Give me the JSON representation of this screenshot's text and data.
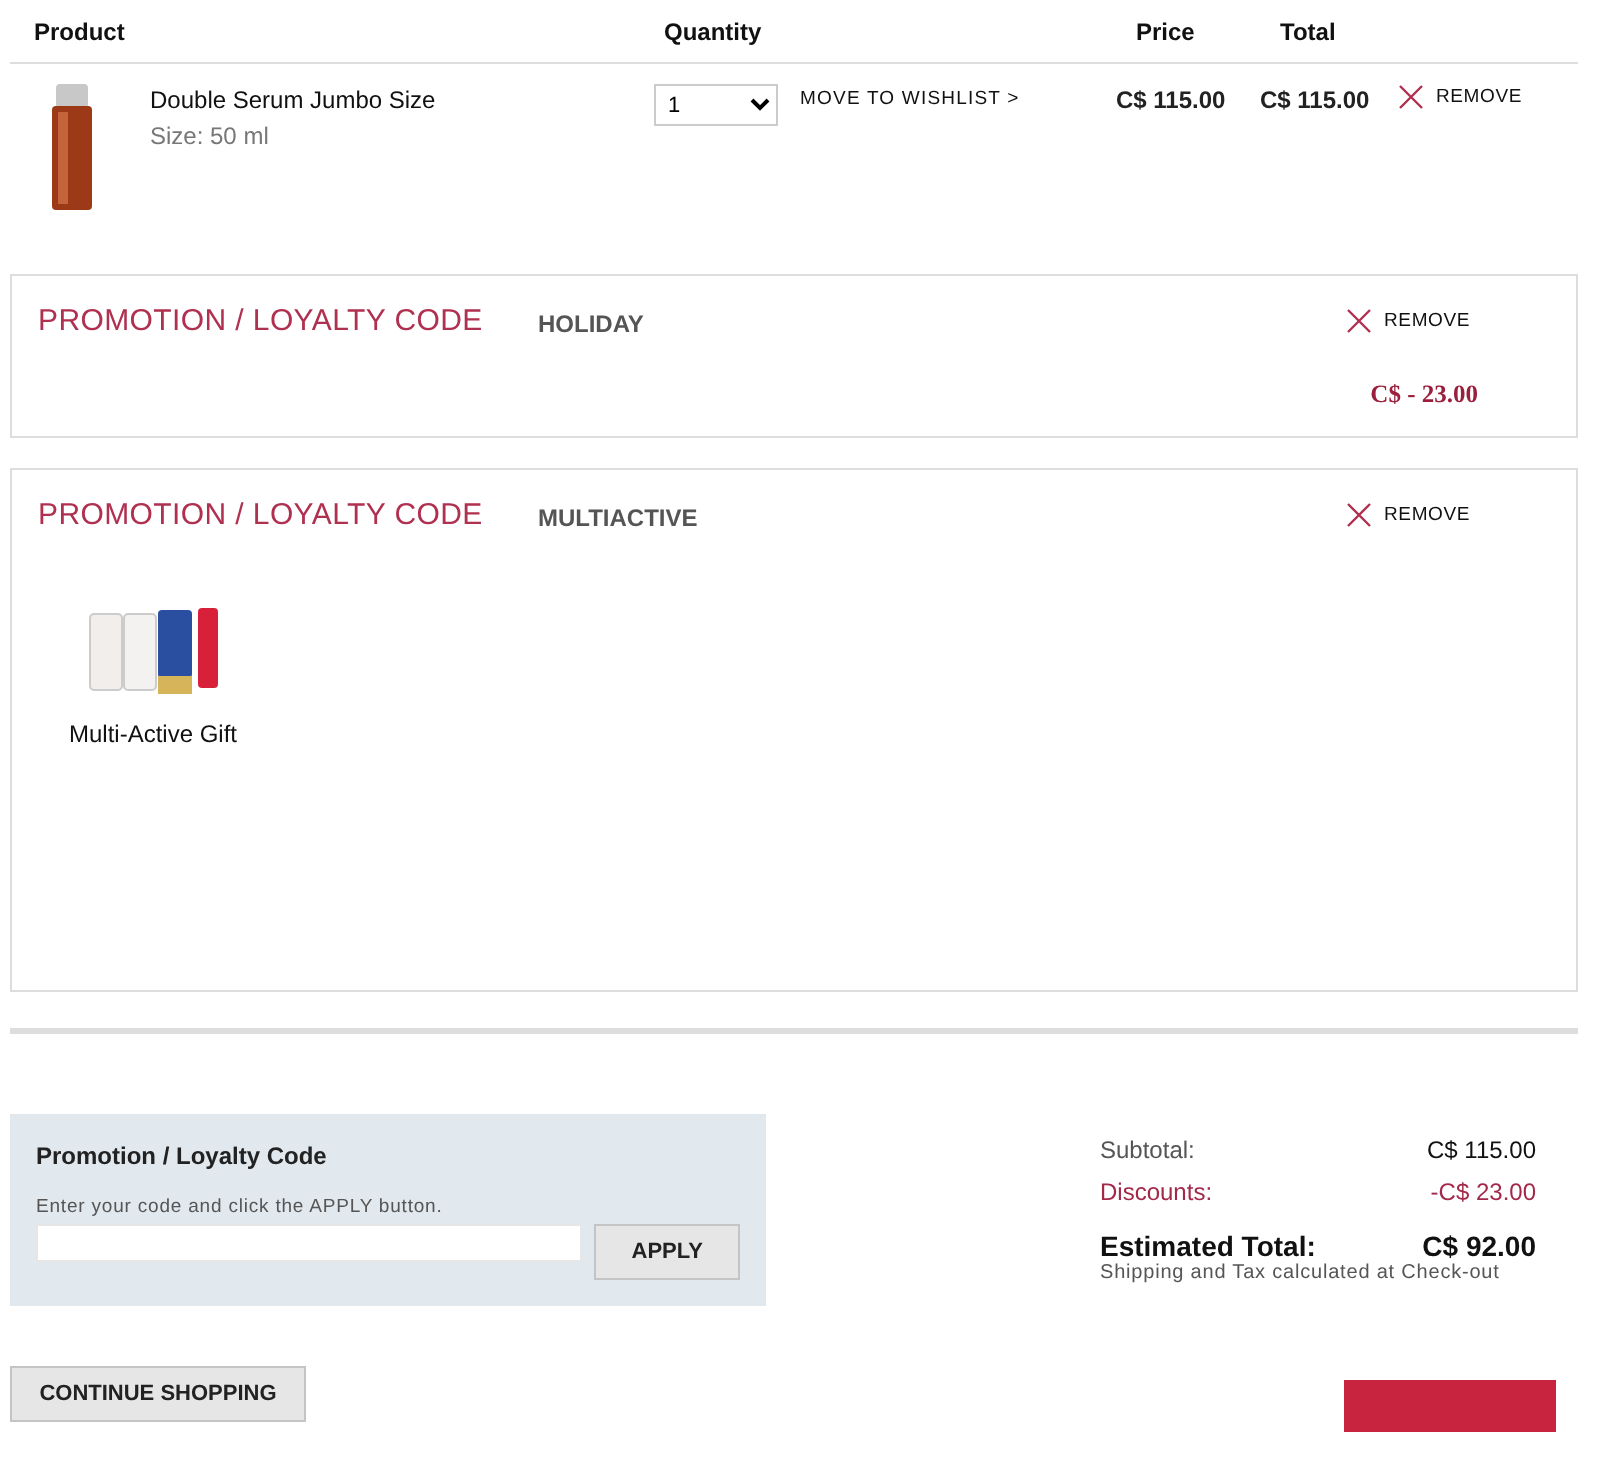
{
  "columns": [
    "Product",
    "Quantity",
    "Price",
    "Total"
  ],
  "items": [
    {
      "name": "Double Serum Jumbo Size",
      "size": "Size: 50 ml",
      "quantity": "1",
      "wishlist": "MOVE TO WISHLIST >",
      "price": "C$ 115.00",
      "total": "C$ 115.00",
      "remove": "REMOVE"
    }
  ],
  "promotions": [
    {
      "kind": "discount",
      "label": "PROMOTION / LOYALTY CODE",
      "code": "HOLIDAY",
      "remove": "REMOVE",
      "amount": "C$ - 23.00"
    },
    {
      "kind": "gift",
      "label": "PROMOTION / LOYALTY CODE",
      "code": "MULTIACTIVE",
      "remove": "REMOVE",
      "gift": "Multi-Active Gift"
    }
  ],
  "promo_form": {
    "title": "Promotion / Loyalty Code",
    "hint": "Enter your code and click the APPLY button.",
    "button": "APPLY"
  },
  "summary": {
    "rows": [
      {
        "kind": "normal",
        "label": "Subtotal:",
        "value": "C$ 115.00"
      },
      {
        "kind": "discount",
        "label": "Discounts:",
        "value": "-C$ 23.00"
      },
      {
        "kind": "total",
        "label": "Estimated Total:",
        "value": "C$ 92.00"
      }
    ],
    "note": "Shipping and Tax calculated at Check-out"
  },
  "continue_button": "CONTINUE SHOPPING"
}
